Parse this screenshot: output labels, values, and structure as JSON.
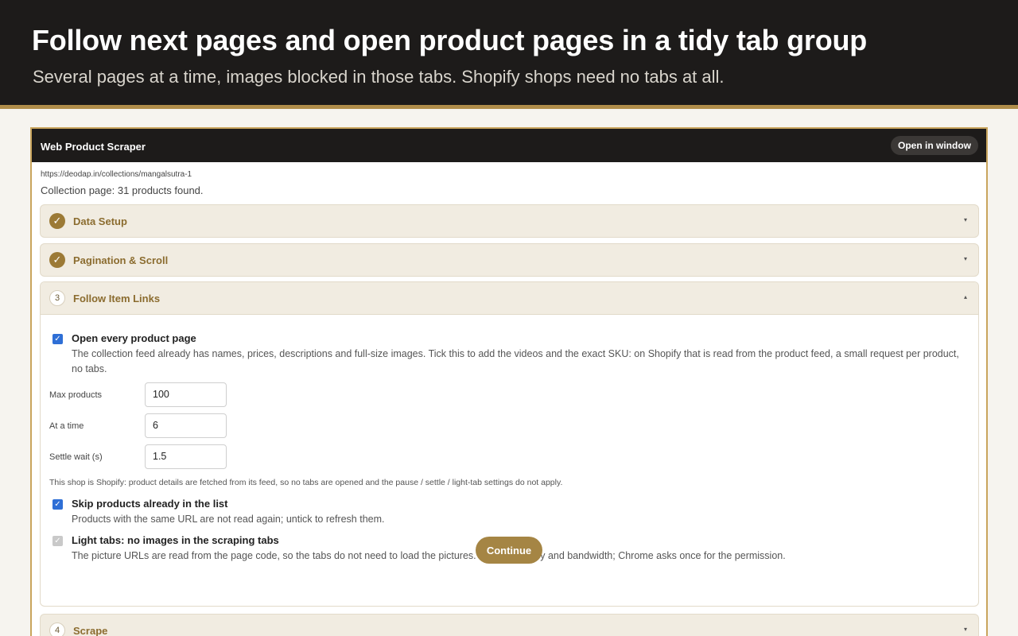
{
  "banner": {
    "headline": "Follow next pages and open product pages in a tidy tab group",
    "subline": "Several pages at a time, images blocked in those tabs. Shopify shops need no tabs at all."
  },
  "panel": {
    "title": "Web Product Scraper",
    "open_in_window_label": "Open in window",
    "url": "https://deodap.in/collections/mangalsutra-1",
    "status": "Collection page: 31 products found."
  },
  "steps": [
    {
      "badge": "✓",
      "label": "Data Setup",
      "state": "done",
      "caret": "▾"
    },
    {
      "badge": "✓",
      "label": "Pagination & Scroll",
      "state": "done",
      "caret": "▾"
    },
    {
      "badge": "3",
      "label": "Follow Item Links",
      "state": "open",
      "caret": "▴"
    },
    {
      "badge": "4",
      "label": "Scrape",
      "state": "collapsed",
      "caret": "▾"
    }
  ],
  "follow_links": {
    "open_every": {
      "checked": true,
      "title": "Open every product page",
      "desc": "The collection feed already has names, prices, descriptions and full-size images. Tick this to add the videos and the exact SKU: on Shopify that is read from the product feed, a small request per product, no tabs."
    },
    "fields": [
      {
        "label": "Max products",
        "value": "100"
      },
      {
        "label": "At a time",
        "value": "6"
      },
      {
        "label": "Settle wait (s)",
        "value": "1.5"
      }
    ],
    "shopify_note": "This shop is Shopify: product details are fetched from its feed, so no tabs are opened and the pause / settle / light-tab settings do not apply.",
    "skip_existing": {
      "checked": true,
      "title": "Skip products already in the list",
      "desc": "Products with the same URL are not read again; untick to refresh them."
    },
    "light_tabs": {
      "checked": true,
      "disabled": true,
      "title": "Light tabs: no images in the scraping tabs",
      "desc": "The picture URLs are read from the page code, so the tabs do not need to load the pictures. Saves memory and bandwidth; Chrome asks once for the permission."
    },
    "continue_label": "Continue"
  },
  "colors": {
    "accent": "#9c7a36",
    "banner_bg": "#1d1b1a",
    "panel_border": "#c9a55d",
    "checkbox": "#2f6fd6"
  }
}
